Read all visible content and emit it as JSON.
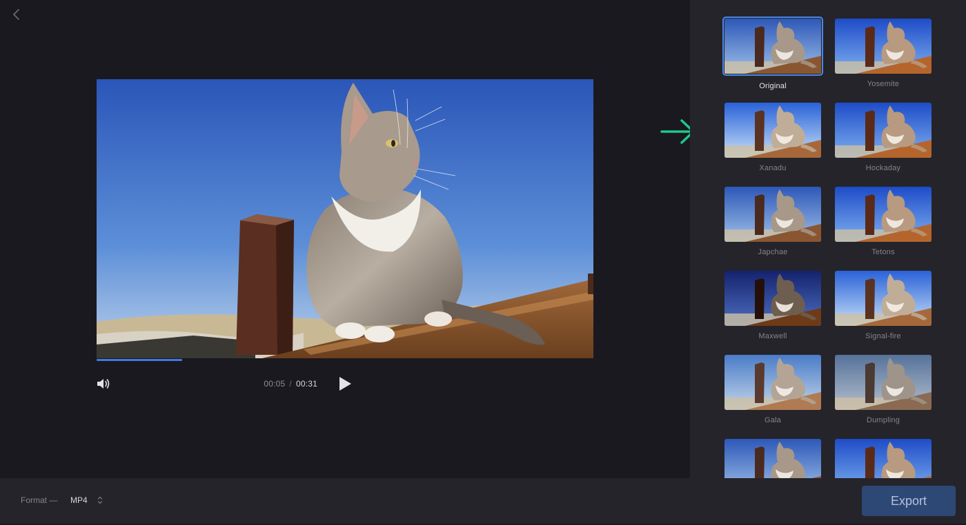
{
  "player": {
    "current_time": "00:05",
    "separator": "/",
    "total_time": "00:31",
    "progress": 0.172
  },
  "filters": [
    {
      "name": "Original",
      "selected": true,
      "tone": "original"
    },
    {
      "name": "Yosemite",
      "selected": false,
      "tone": "vivid"
    },
    {
      "name": "Xanadu",
      "selected": false,
      "tone": "bright"
    },
    {
      "name": "Hockaday",
      "selected": false,
      "tone": "vivid"
    },
    {
      "name": "Japchae",
      "selected": false,
      "tone": "original"
    },
    {
      "name": "Tetons",
      "selected": false,
      "tone": "vivid"
    },
    {
      "name": "Maxwell",
      "selected": false,
      "tone": "dark"
    },
    {
      "name": "Signal-fire",
      "selected": false,
      "tone": "bright"
    },
    {
      "name": "Gala",
      "selected": false,
      "tone": "soft"
    },
    {
      "name": "Dumpling",
      "selected": false,
      "tone": "muted"
    },
    {
      "name": "",
      "selected": false,
      "tone": "original"
    },
    {
      "name": "",
      "selected": false,
      "tone": "vivid"
    }
  ],
  "footer": {
    "format_label": "Format —",
    "format_value": "MP4",
    "export_label": "Export"
  },
  "colors": {
    "accent": "#4a88e8",
    "arrow": "#1ec98a",
    "export_bg": "#2e4876"
  },
  "icons": {
    "back": "chevron-left-icon",
    "volume": "volume-icon",
    "play": "play-icon",
    "select": "updown-chevron-icon",
    "arrow": "arrow-right-icon"
  }
}
